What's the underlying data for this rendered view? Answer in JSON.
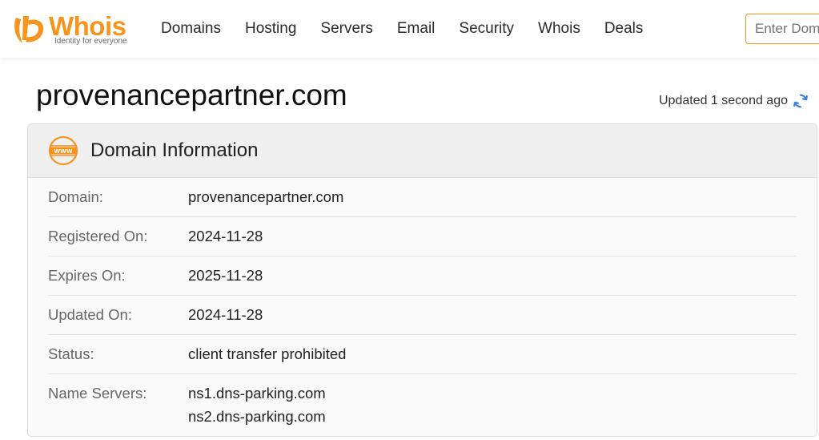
{
  "brand": {
    "name": "Whois",
    "tagline": "Identity for everyone",
    "color": "#f7941d"
  },
  "nav": {
    "items": [
      "Domains",
      "Hosting",
      "Servers",
      "Email",
      "Security",
      "Whois",
      "Deals"
    ]
  },
  "search": {
    "placeholder": "Enter Domain"
  },
  "page": {
    "title": "provenancepartner.com",
    "updated": "Updated 1 second ago"
  },
  "domain_info": {
    "header": "Domain Information",
    "icon": "www-icon",
    "rows": [
      {
        "label": "Domain:",
        "value": "provenancepartner.com"
      },
      {
        "label": "Registered On:",
        "value": "2024-11-28"
      },
      {
        "label": "Expires On:",
        "value": "2025-11-28"
      },
      {
        "label": "Updated On:",
        "value": "2024-11-28"
      },
      {
        "label": "Status:",
        "value": "client transfer prohibited"
      }
    ],
    "name_servers": {
      "label": "Name Servers:",
      "values": [
        "ns1.dns-parking.com",
        "ns2.dns-parking.com"
      ]
    }
  }
}
